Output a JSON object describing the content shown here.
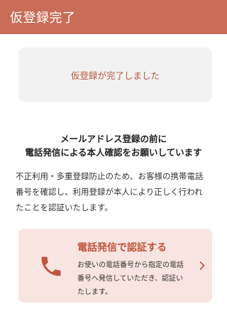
{
  "header": {
    "title": "仮登録完了"
  },
  "notice": {
    "text": "仮登録が完了しました"
  },
  "headline": {
    "lines": [
      "メールアドレス登録の前に",
      "電話発信による本人確認をお願いしています"
    ]
  },
  "body": {
    "lines": [
      "不正利用・多重登録防止のため、お客様の携帯電話",
      "番号を確認し、利用登録が本人により正しく行われ",
      "たことを認証いたします。"
    ]
  },
  "call_card": {
    "title": "電話発信で認証する",
    "desc_lines": [
      "お使いの電話番号から指定の電話",
      "番号へ発信していただき、認証い",
      "たします。"
    ],
    "icon": "phone-icon",
    "chevron": "chevron-right-icon"
  },
  "colors": {
    "header_bg": "#c96d58",
    "accent": "#c0553c",
    "card_bg": "#f8e5e1",
    "notice_bg": "#f2f2f2"
  }
}
